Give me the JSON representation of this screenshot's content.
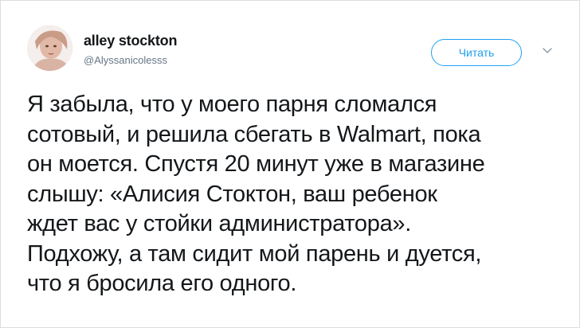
{
  "tweet": {
    "display_name": "alley stockton",
    "handle": "@Alyssanicolesss",
    "follow_label": "Читать",
    "menu_icon": "chevron-down-icon",
    "avatar_icon": "avatar-photo",
    "lines": [
      "Я забыла, что у моего парня сломался",
      "сотовый, и решила сбегать в Walmart, пока",
      "он моется. Спустя 20 минут уже в магазине",
      "слышу: «Алисия Стоктон, ваш ребенок",
      "ждет вас у стойки администратора».",
      "Подхожу, а там сидит мой парень и дуется,",
      "что я бросила его одного."
    ]
  },
  "colors": {
    "accent": "#1da1f2",
    "text": "#14171a",
    "muted": "#657786",
    "border": "#d9dde1"
  }
}
